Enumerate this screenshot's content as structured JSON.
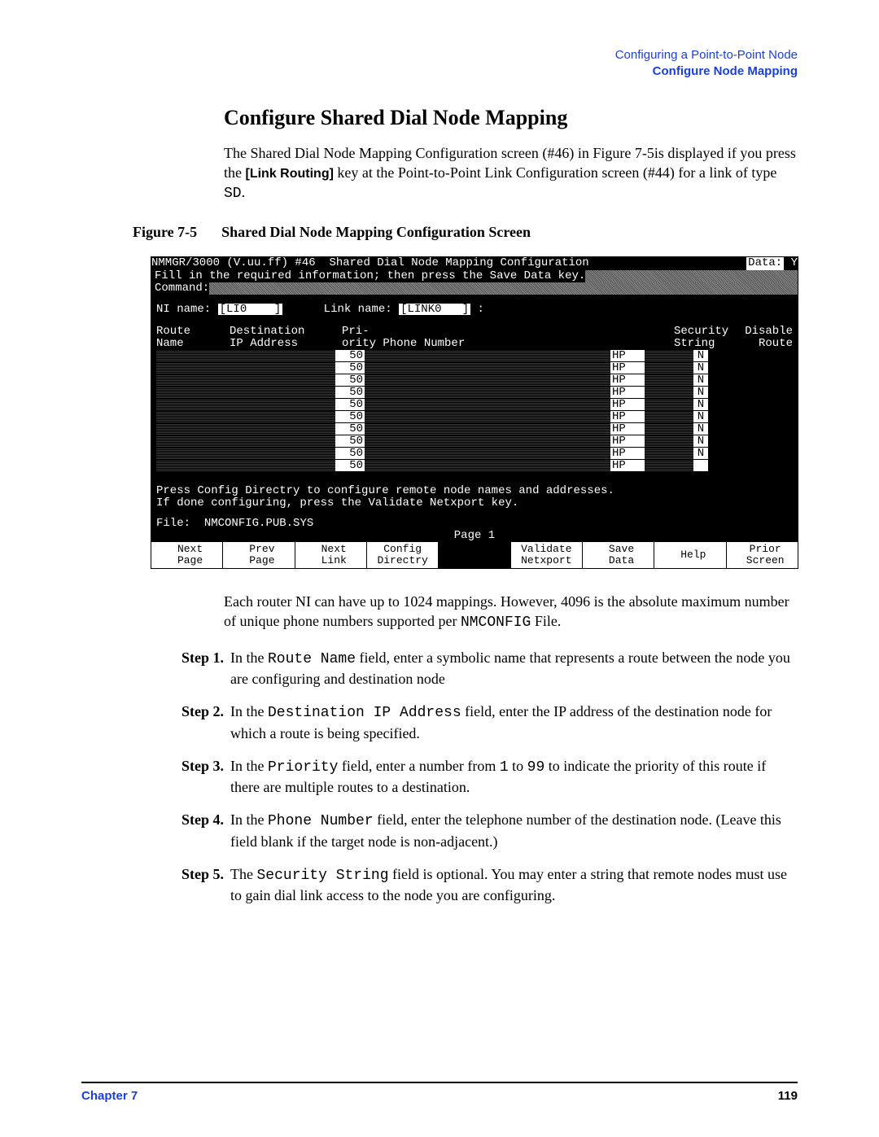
{
  "header": {
    "line1": "Configuring a Point-to-Point Node",
    "line2": "Configure Node Mapping"
  },
  "title": "Configure Shared Dial Node Mapping",
  "intro": {
    "pre_link": "The Shared Dial Node Mapping Configuration screen (#46) in Figure 7-5is displayed if you press the ",
    "link_routing": "[Link Routing]",
    "post_link": " key at the Point-to-Point Link Configuration screen (#44) for a link of type ",
    "sd_code": "SD",
    "period": "."
  },
  "figure": {
    "label": "Figure 7-5",
    "title": "Shared Dial Node Mapping Configuration Screen"
  },
  "terminal": {
    "title_left": "NMMGR/3000 (V.uu.ff) #46",
    "title_mid": "  Shared Dial Node Mapping Configuration",
    "data_label": "Data:",
    "data_val": " Y",
    "fill_line": "Fill in the required information; then press the Save Data key.",
    "command_label": "Command:",
    "ni_label": "NI name:",
    "ni_value": "[LI0    ]",
    "link_label": "Link name:",
    "link_value": "[LINK0   ]",
    "colon_after": " :",
    "col_headers": {
      "route": "Route",
      "name": "Name",
      "dest": "Destination",
      "ip": "IP Address",
      "pri": "Pri-",
      "ority": "ority",
      "phone": "Phone Number",
      "security": "Security",
      "string": "String",
      "disable": "Disable",
      "route2": "Route"
    },
    "rows": [
      {
        "pri": "50",
        "sec": "HP",
        "dis": "N"
      },
      {
        "pri": "50",
        "sec": "HP",
        "dis": "N"
      },
      {
        "pri": "50",
        "sec": "HP",
        "dis": "N"
      },
      {
        "pri": "50",
        "sec": "HP",
        "dis": "N"
      },
      {
        "pri": "50",
        "sec": "HP",
        "dis": "N"
      },
      {
        "pri": "50",
        "sec": "HP",
        "dis": "N"
      },
      {
        "pri": "50",
        "sec": "HP",
        "dis": "N"
      },
      {
        "pri": "50",
        "sec": "HP",
        "dis": "N"
      },
      {
        "pri": "50",
        "sec": "HP",
        "dis": "N"
      },
      {
        "pri": "50",
        "sec": "HP",
        "dis": ""
      }
    ],
    "hint1": "Press Config Directry to configure remote node names and addresses.",
    "hint2": "If done configuring, press the Validate Netxport key.",
    "file_label": "File:",
    "file_value": "NMCONFIG.PUB.SYS",
    "page_label": "Page 1",
    "softkeys": [
      {
        "l1": " Next",
        "l2": " Page"
      },
      {
        "l1": " Prev",
        "l2": " Page"
      },
      {
        "l1": " Next",
        "l2": " Link"
      },
      {
        "l1": "Config",
        "l2": "Directry"
      },
      {
        "l1": "",
        "l2": "",
        "blank": true
      },
      {
        "l1": "Validate",
        "l2": "Netxport"
      },
      {
        "l1": " Save",
        "l2": " Data"
      },
      {
        "l1": " Help",
        "l2": ""
      },
      {
        "l1": " Prior",
        "l2": " Screen"
      }
    ]
  },
  "after_fig": {
    "para_pre": "Each router NI can have up to 1024 mappings. However, 4096 is the absolute maximum number of unique phone numbers supported per ",
    "nmconfig": "NMCONFIG",
    "para_post": " File."
  },
  "steps": [
    {
      "label": "Step 1.",
      "pre": "In the ",
      "code": "Route Name",
      "post": " field, enter a symbolic name that represents a route between the node you are configuring and destination node"
    },
    {
      "label": "Step 2.",
      "pre": "In the ",
      "code": "Destination IP Address",
      "post": " field, enter the IP address of the destination node for which a route is being specified."
    },
    {
      "label": "Step 3.",
      "pre": "In the ",
      "code": "Priority",
      "mid1": " field, enter a number from ",
      "code2": "1",
      "mid2": " to ",
      "code3": "99",
      "post": " to indicate the priority of this route if there are multiple routes to a destination."
    },
    {
      "label": "Step 4.",
      "pre": "In the ",
      "code": "Phone Number",
      "post": " field, enter the telephone number of the destination node. (Leave this field blank if the target node is non-adjacent.)"
    },
    {
      "label": "Step 5.",
      "pre": "The ",
      "code": "Security String",
      "post": " field is optional. You may enter a string that remote nodes must use to gain dial link access to the node you are configuring."
    }
  ],
  "footer": {
    "chapter": "Chapter 7",
    "page": "119"
  }
}
